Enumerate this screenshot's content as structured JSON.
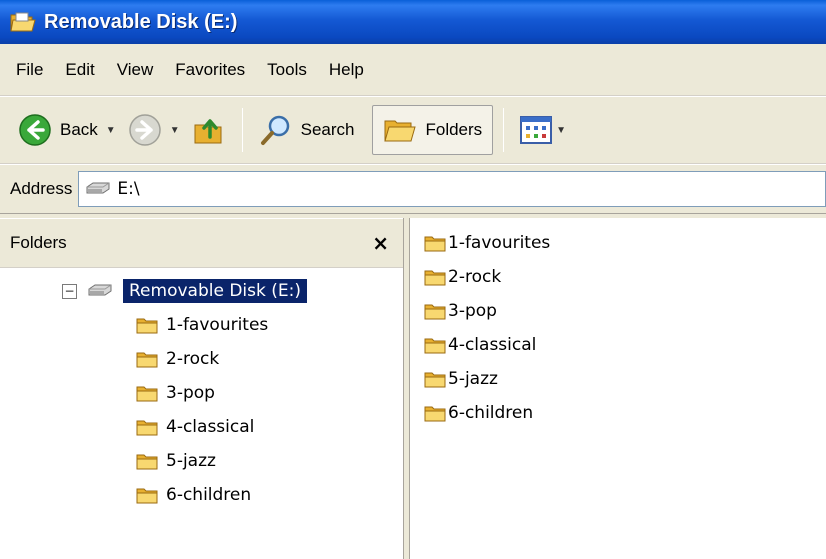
{
  "window": {
    "title": "Removable Disk (E:)",
    "title_icon": "folder-open-icon"
  },
  "menu": {
    "items": [
      "File",
      "Edit",
      "View",
      "Favorites",
      "Tools",
      "Help"
    ]
  },
  "toolbar": {
    "back_label": "Back",
    "search_label": "Search",
    "folders_label": "Folders"
  },
  "address": {
    "label": "Address",
    "value": "E:\\",
    "icon": "drive-icon"
  },
  "folders_pane": {
    "title": "Folders",
    "close_label": "×",
    "root": {
      "label": "Removable Disk (E:)",
      "expander": "−",
      "icon": "drive-icon"
    },
    "children": [
      {
        "label": "1-favourites"
      },
      {
        "label": "2-rock"
      },
      {
        "label": "3-pop"
      },
      {
        "label": "4-classical"
      },
      {
        "label": "5-jazz"
      },
      {
        "label": "6-children"
      }
    ]
  },
  "content": {
    "items": [
      {
        "label": "1-favourites"
      },
      {
        "label": "2-rock"
      },
      {
        "label": "3-pop"
      },
      {
        "label": "4-classical"
      },
      {
        "label": "5-jazz"
      },
      {
        "label": "6-children"
      }
    ]
  },
  "colors": {
    "titlebar": "#0A48C0",
    "selection": "#0A246A",
    "folder": "#F5C54A",
    "chrome": "#ECE9D8"
  }
}
